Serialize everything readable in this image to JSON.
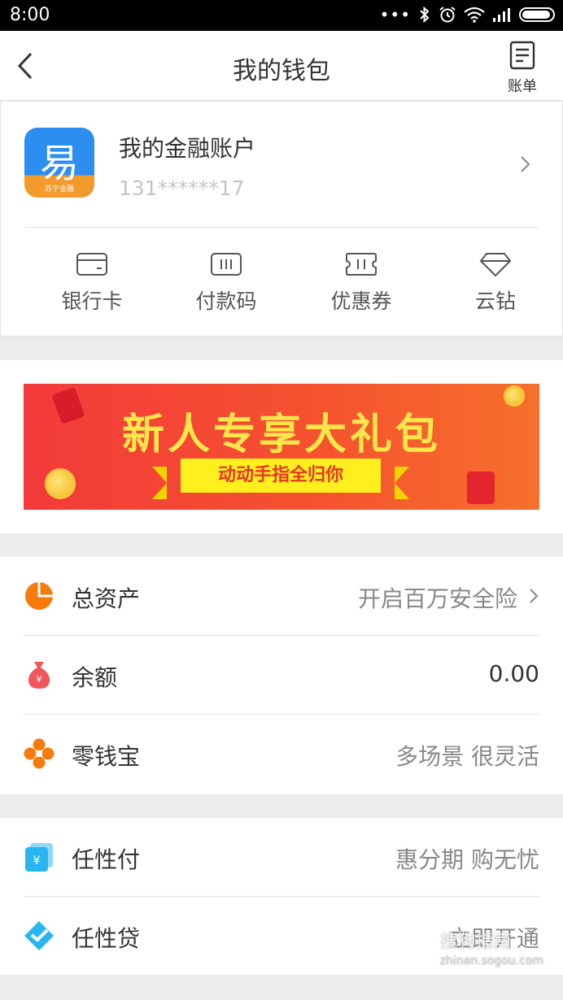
{
  "status_bar": {
    "time": "8:00"
  },
  "nav": {
    "title": "我的钱包",
    "bill_label": "账单"
  },
  "account": {
    "logo_glyph": "易",
    "logo_text": "苏宁金融",
    "name": "我的金融账户",
    "phone": "131******17"
  },
  "quick_actions": [
    {
      "label": "银行卡",
      "icon": "bank-card-icon"
    },
    {
      "label": "付款码",
      "icon": "payment-code-icon"
    },
    {
      "label": "优惠券",
      "icon": "coupon-icon"
    },
    {
      "label": "云钻",
      "icon": "diamond-icon"
    }
  ],
  "banner": {
    "headline": "新人专享大礼包",
    "ribbon": "动动手指全归你"
  },
  "assets": [
    {
      "label": "总资产",
      "value": "开启百万安全险",
      "icon": "pie-chart-icon",
      "color": "#f57c0c"
    },
    {
      "label": "余额",
      "value": "0.00",
      "icon": "money-bag-icon",
      "color": "#f0565a"
    },
    {
      "label": "零钱宝",
      "value": "多场景 很灵活",
      "icon": "clover-icon",
      "color": "#f57c0c"
    }
  ],
  "credit": [
    {
      "label": "任性付",
      "value": "惠分期 购无忧",
      "icon": "cards-icon",
      "color": "#27b6ef"
    },
    {
      "label": "任性贷",
      "value": "立即开通",
      "icon": "loan-icon",
      "color": "#27b6ef"
    }
  ],
  "watermark": {
    "text": "搜狗指南",
    "url": "zhinan.sogou.com"
  }
}
